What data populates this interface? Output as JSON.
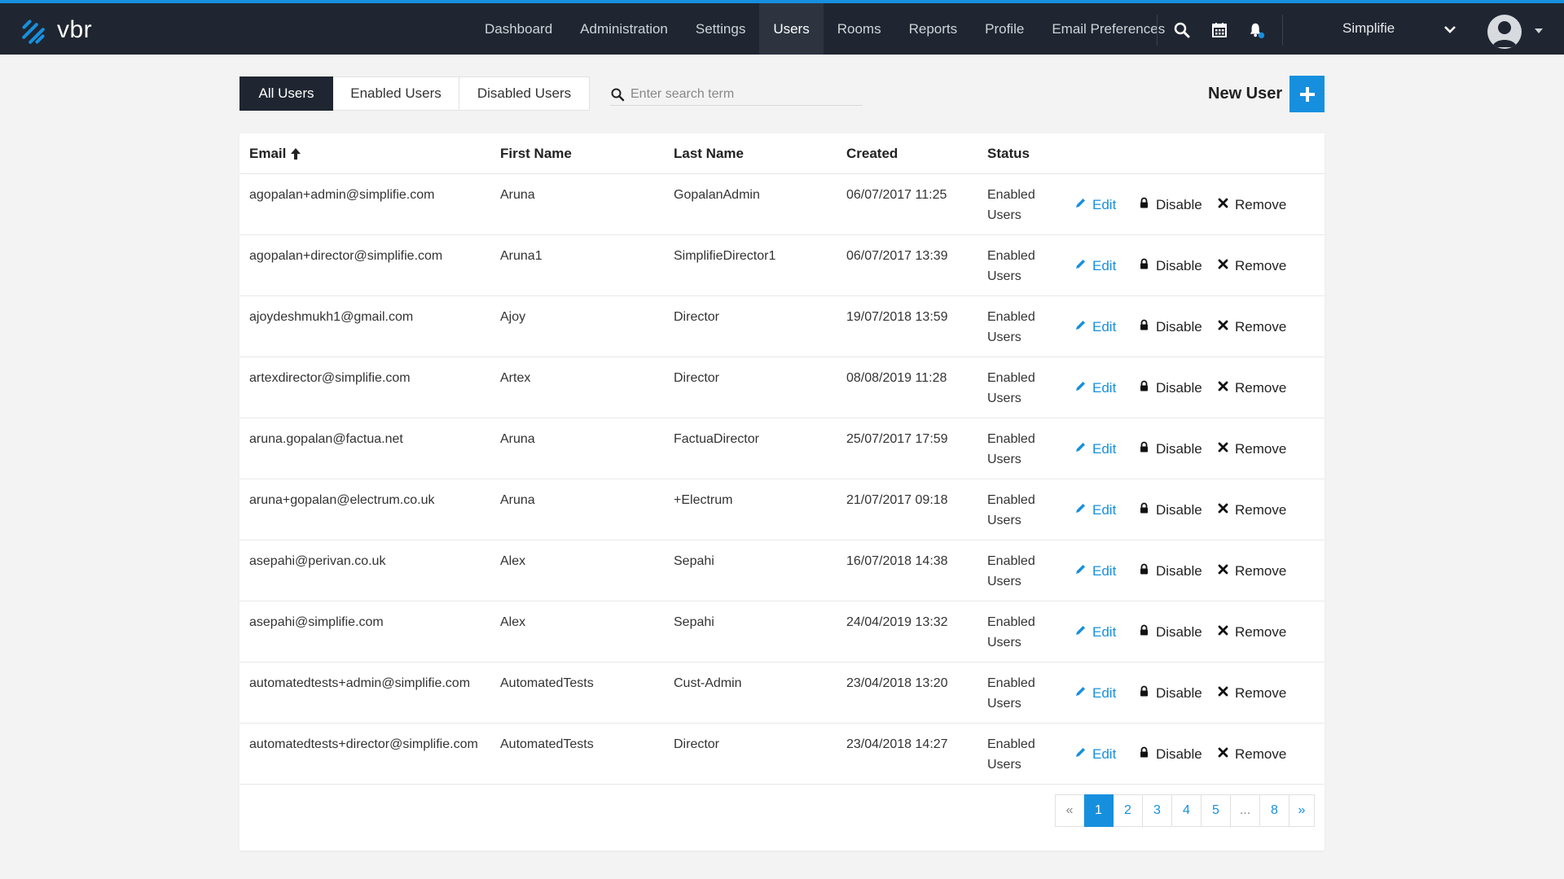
{
  "brand": {
    "name": "vbr",
    "accent": "#1690de",
    "nav_bg": "#1f2631"
  },
  "nav": {
    "items": [
      {
        "label": "Dashboard",
        "active": false
      },
      {
        "label": "Administration",
        "active": false
      },
      {
        "label": "Settings",
        "active": false
      },
      {
        "label": "Users",
        "active": true
      },
      {
        "label": "Rooms",
        "active": false
      },
      {
        "label": "Reports",
        "active": false
      },
      {
        "label": "Profile",
        "active": false
      },
      {
        "label": "Email Preferences",
        "active": false
      }
    ],
    "icons": [
      "search-icon",
      "calendar-icon",
      "bell-icon"
    ],
    "account": "Simplifie"
  },
  "tabs": [
    {
      "label": "All Users",
      "active": true
    },
    {
      "label": "Enabled Users",
      "active": false
    },
    {
      "label": "Disabled Users",
      "active": false
    }
  ],
  "search": {
    "placeholder": "Enter search term",
    "value": ""
  },
  "new_user_label": "New User",
  "table": {
    "headers": {
      "email": "Email",
      "first": "First Name",
      "last": "Last Name",
      "created": "Created",
      "status": "Status"
    },
    "sort": {
      "column": "email",
      "direction": "ascending"
    },
    "actions": {
      "edit": "Edit",
      "disable": "Disable",
      "remove": "Remove"
    },
    "rows": [
      {
        "email": "agopalan+admin@simplifie.com",
        "first": "Aruna",
        "last": "GopalanAdmin",
        "created": "06/07/2017 11:25",
        "status": "Enabled Users"
      },
      {
        "email": "agopalan+director@simplifie.com",
        "first": "Aruna1",
        "last": "SimplifieDirector1",
        "created": "06/07/2017 13:39",
        "status": "Enabled Users"
      },
      {
        "email": "ajoydeshmukh1@gmail.com",
        "first": "Ajoy",
        "last": "Director",
        "created": "19/07/2018 13:59",
        "status": "Enabled Users"
      },
      {
        "email": "artexdirector@simplifie.com",
        "first": "Artex",
        "last": "Director",
        "created": "08/08/2019 11:28",
        "status": "Enabled Users"
      },
      {
        "email": "aruna.gopalan@factua.net",
        "first": "Aruna",
        "last": "FactuaDirector",
        "created": "25/07/2017 17:59",
        "status": "Enabled Users"
      },
      {
        "email": "aruna+gopalan@electrum.co.uk",
        "first": "Aruna",
        "last": "+Electrum",
        "created": "21/07/2017 09:18",
        "status": "Enabled Users"
      },
      {
        "email": "asepahi@perivan.co.uk",
        "first": "Alex",
        "last": "Sepahi",
        "created": "16/07/2018 14:38",
        "status": "Enabled Users"
      },
      {
        "email": "asepahi@simplifie.com",
        "first": "Alex",
        "last": "Sepahi",
        "created": "24/04/2019 13:32",
        "status": "Enabled Users"
      },
      {
        "email": "automatedtests+admin@simplifie.com",
        "first": "AutomatedTests",
        "last": "Cust-Admin",
        "created": "23/04/2018 13:20",
        "status": "Enabled Users"
      },
      {
        "email": "automatedtests+director@simplifie.com",
        "first": "AutomatedTests",
        "last": "Director",
        "created": "23/04/2018 14:27",
        "status": "Enabled Users"
      }
    ]
  },
  "pagination": {
    "prev": "«",
    "pages": [
      "1",
      "2",
      "3",
      "4",
      "5",
      "...",
      "8"
    ],
    "current": "1",
    "next": "»"
  }
}
